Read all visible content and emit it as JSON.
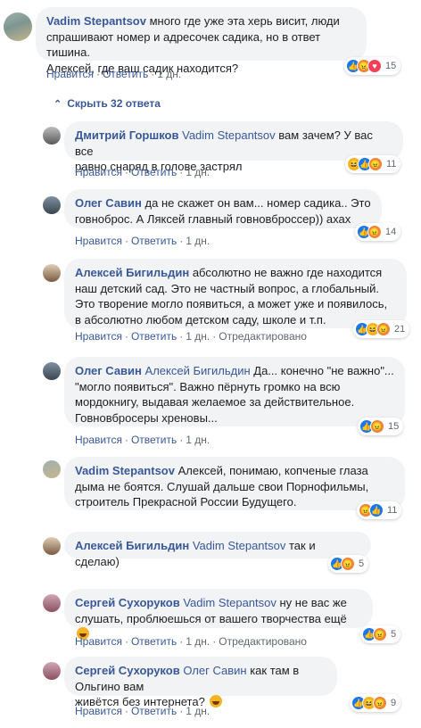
{
  "comments": [
    {
      "author": "Vadim Stepantsov",
      "lines": [
        "много где уже эта херь висит, люди",
        "спрашивают номер и адресочек садика, но в ответ тишина.",
        "Алексей, где ваш садик находится?"
      ],
      "like": "Нравится",
      "reply": "Ответить",
      "time": "1 дн.",
      "reactions": [
        "like",
        "angry",
        "love"
      ],
      "count": "15",
      "avatar_colors": [
        "#8aa0a0",
        "#c6b48f"
      ]
    },
    {
      "author": "Дмитрий Горшков",
      "mention": "Vadim Stepantsov",
      "lines": [
        "вам зачем? У вас все",
        "равно снаряд в голове застрял"
      ],
      "like": "Нравится",
      "reply": "Ответить",
      "time": "1 дн.",
      "reactions": [
        "haha",
        "like",
        "angry"
      ],
      "count": "11",
      "avatar_colors": [
        "#a8a8a8",
        "#5a5a5a"
      ]
    },
    {
      "author": "Олег Савин",
      "lines": [
        "да не скажет он вам... номер садика.. Это",
        "говноброс. А Ляксей главный говновброссер)) ахах"
      ],
      "like": "Нравится",
      "reply": "Ответить",
      "time": "1 дн.",
      "reactions": [
        "like",
        "angry"
      ],
      "count": "14",
      "avatar_colors": [
        "#6f7f8e",
        "#3a4650"
      ]
    },
    {
      "author": "Алексей Бигильдин",
      "lines": [
        "абсолютно не важно где находится",
        "наш детский сад. Это не частный вопрос, а глобальный.",
        "Это творение могло появиться, а может уже и появилось,",
        "в абсолютно любом детском саду, школе и т.п."
      ],
      "like": "Нравится",
      "reply": "Ответить",
      "time": "1 дн.",
      "edited": "Отредактировано",
      "reactions": [
        "like",
        "haha",
        "angry"
      ],
      "count": "21",
      "avatar_colors": [
        "#d9c7b0",
        "#7a5a40"
      ]
    },
    {
      "author": "Олег Савин",
      "mention": "Алексей Бигильдин",
      "lines": [
        "Да... конечно \"не важно\"...",
        "\"могло появиться\". Важно пёрнуть громко на всю",
        "мордокнигу, выдавая желаемое за действительное.",
        "Говновбросеры хреновы..."
      ],
      "like": "Нравится",
      "reply": "Ответить",
      "time": "1 дн.",
      "reactions": [
        "like",
        "angry"
      ],
      "count": "15",
      "avatar_colors": [
        "#6f7f8e",
        "#3a4650"
      ]
    },
    {
      "author": "Vadim Stepantsov",
      "lines": [
        "Алексей, понимаю, копченые глаза",
        "дыма не боятся. Слушай дальше свои Порнофильмы,",
        "строитель Прекрасной России Будущего."
      ],
      "like": "Нравится",
      "reply": "Ответить",
      "time": "1 дн.",
      "reactions": [
        "angry",
        "like"
      ],
      "count": "11",
      "avatar_colors": [
        "#8aa0a0",
        "#c6b48f"
      ]
    },
    {
      "author": "Алексей Бигильдин",
      "mention": "Vadim Stepantsov",
      "lines": [
        "так и сделаю)"
      ],
      "like": "Нравится",
      "reply": "Ответить",
      "time": "1 дн.",
      "reactions": [
        "like",
        "angry"
      ],
      "count": "5",
      "avatar_colors": [
        "#d9c7b0",
        "#7a5a40"
      ]
    },
    {
      "author": "Сергей Сухоруков",
      "mention": "Vadim Stepantsov",
      "lines": [
        "ну не вас же",
        "слушать, проблюешься от вашего творчества ещё"
      ],
      "like": "Нравится",
      "reply": "Ответить",
      "time": "1 дн.",
      "edited": "Отредактировано",
      "reactions": [
        "like",
        "angry"
      ],
      "count": "5",
      "avatar_colors": [
        "#c9a0b0",
        "#8a5060"
      ]
    },
    {
      "author": "Сергей Сухоруков",
      "mention": "Олег Савин",
      "lines": [
        "как там в Ольгино вам",
        "живётся без интернета?"
      ],
      "like": "Нравится",
      "reply": "Ответить",
      "time": "1 дн.",
      "reactions": [
        "like",
        "haha",
        "angry"
      ],
      "count": "9",
      "avatar_colors": [
        "#c9a0b0",
        "#8a5060"
      ]
    }
  ],
  "replies_toggle": "Скрыть 32 ответа",
  "separator": "·"
}
